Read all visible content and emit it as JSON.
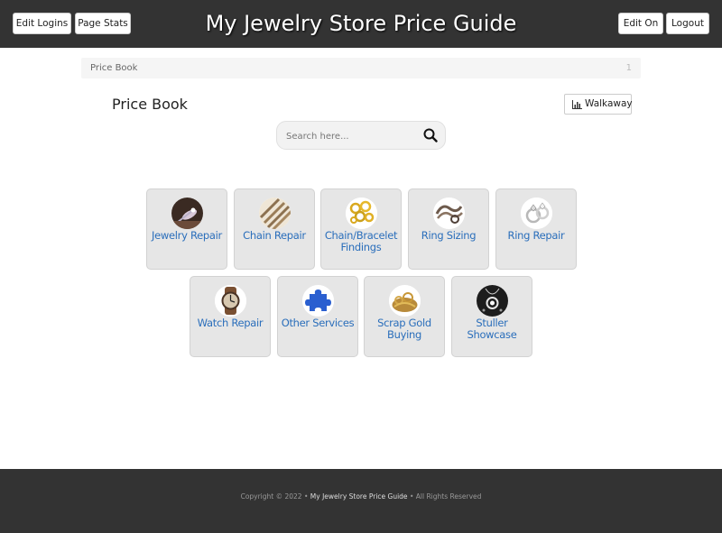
{
  "header": {
    "title": "My Jewelry Store Price Guide",
    "left_buttons": [
      "Edit Logins",
      "Page Stats"
    ],
    "right_buttons": [
      "Edit On",
      "Logout"
    ]
  },
  "breadcrumb": {
    "label": "Price Book",
    "count": "1"
  },
  "page": {
    "title": "Price Book",
    "walkaway_label": "Walkaway",
    "search_placeholder": "Search here..."
  },
  "tiles": [
    {
      "label": "Jewelry Repair",
      "icon": "torch-flame-icon"
    },
    {
      "label": "Chain Repair",
      "icon": "chain-icon"
    },
    {
      "label": "Chain/Bracelet Findings",
      "icon": "gold-findings-icon"
    },
    {
      "label": "Ring Sizing",
      "icon": "ring-sizer-icon"
    },
    {
      "label": "Ring Repair",
      "icon": "diamond-ring-icon"
    },
    {
      "label": "Watch Repair",
      "icon": "watch-icon"
    },
    {
      "label": "Other Services",
      "icon": "puzzle-piece-icon"
    },
    {
      "label": "Scrap Gold Buying",
      "icon": "gold-pile-icon"
    },
    {
      "label": "Stuller Showcase",
      "icon": "pendant-showcase-icon"
    }
  ],
  "footer": {
    "prefix": "Copyright © 2022 •",
    "brand": "My Jewelry Store Price Guide",
    "suffix": "• All Rights Reserved"
  },
  "colors": {
    "bar": "#333333",
    "tile_bg": "#e6e6e6",
    "tile_label": "#2a6ebb"
  }
}
